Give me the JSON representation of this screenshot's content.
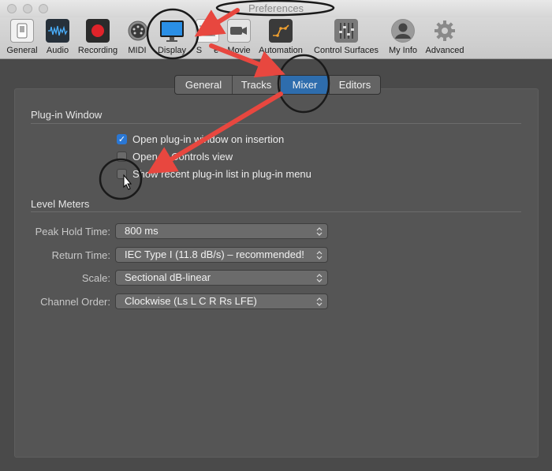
{
  "window": {
    "title": "Preferences"
  },
  "toolbar": {
    "items": [
      {
        "label": "General",
        "icon": "switch-icon"
      },
      {
        "label": "Audio",
        "icon": "waveform-icon"
      },
      {
        "label": "Recording",
        "icon": "record-icon"
      },
      {
        "label": "MIDI",
        "icon": "midi-connector-icon"
      },
      {
        "label": "Display",
        "icon": "monitor-icon"
      },
      {
        "label": "Score",
        "icon": "score-icon"
      },
      {
        "label": "Movie",
        "icon": "camera-icon"
      },
      {
        "label": "Automation",
        "icon": "automation-icon"
      },
      {
        "label": "Control Surfaces",
        "icon": "faders-icon"
      },
      {
        "label": "My Info",
        "icon": "user-icon"
      },
      {
        "label": "Advanced",
        "icon": "gear-icon"
      }
    ],
    "visible_labels": {
      "score": "S",
      "score_end": "e"
    }
  },
  "tabs": [
    {
      "label": "General"
    },
    {
      "label": "Tracks"
    },
    {
      "label": "Mixer",
      "selected": true
    },
    {
      "label": "Editors"
    }
  ],
  "plugin_window": {
    "title": "Plug-in Window",
    "options": [
      {
        "label": "Open plug-in window on insertion",
        "checked": true
      },
      {
        "label": "Open in Controls view",
        "checked": false
      },
      {
        "label": "Show recent plug-in list in plug-in menu",
        "checked": false
      }
    ]
  },
  "level_meters": {
    "title": "Level Meters",
    "rows": [
      {
        "label": "Peak Hold Time:",
        "value": "800 ms"
      },
      {
        "label": "Return Time:",
        "value": "IEC Type I (11.8 dB/s) – recommended!"
      },
      {
        "label": "Scale:",
        "value": "Sectional dB-linear"
      },
      {
        "label": "Channel Order:",
        "value": "Clockwise (Ls L C R Rs LFE)"
      }
    ]
  },
  "colors": {
    "accent": "#2e6dad",
    "annotation_arrow": "#e8473f",
    "annotation_circle": "#1a1a1a"
  }
}
